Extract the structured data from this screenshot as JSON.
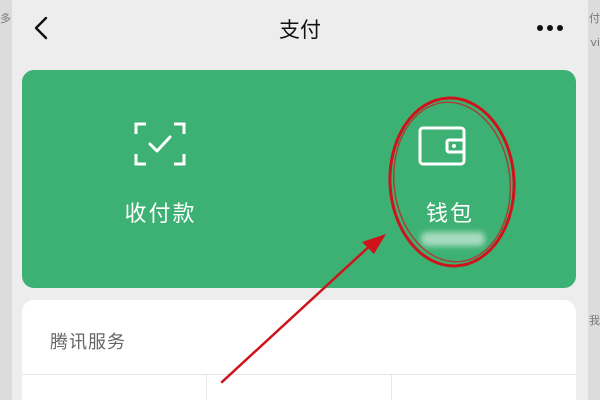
{
  "header": {
    "title": "支付",
    "back_icon": "chevron-left-icon",
    "more_icon": "more-horizontal-icon"
  },
  "pay_card": {
    "background_color": "#3db173",
    "items": [
      {
        "label": "收付款",
        "icon": "scan-check-icon"
      },
      {
        "label": "钱包",
        "icon": "wallet-icon"
      }
    ]
  },
  "services": {
    "title": "腾讯服务"
  },
  "annotation": {
    "ellipse_color": "#d0121b",
    "arrow_color": "#d0121b"
  },
  "edge_fragments": {
    "left": "多",
    "right_top": "付",
    "right_mid": "vi",
    "right_low": "我"
  }
}
